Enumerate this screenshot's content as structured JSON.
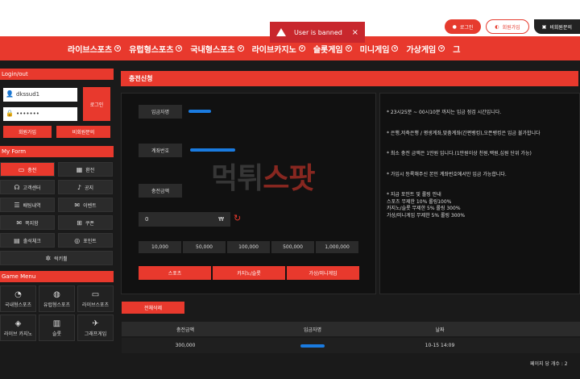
{
  "toast": {
    "message": "User is banned",
    "close": "×"
  },
  "top_buttons": [
    {
      "label": "로그인",
      "icon": "user-icon"
    },
    {
      "label": "회원가입",
      "icon": "user-plus-icon"
    },
    {
      "label": "비회원문의",
      "icon": "chat-icon"
    }
  ],
  "nav": [
    {
      "label": "라이브스포츠"
    },
    {
      "label": "유럽형스포츠"
    },
    {
      "label": "국내형스포츠"
    },
    {
      "label": "라이브카지노"
    },
    {
      "label": "슬롯게임"
    },
    {
      "label": "미니게임"
    },
    {
      "label": "가상게임"
    },
    {
      "label": "그"
    }
  ],
  "sidebar": {
    "login_title": "Login/out",
    "username": "dkssud1",
    "password": "•••••••",
    "login_button": "로그인",
    "signup_button": "회원가입",
    "inquiry_button": "비회원문의",
    "myform_title": "My Form",
    "form_items": [
      {
        "label": "충전",
        "icon": "wallet-icon"
      },
      {
        "label": "환전",
        "icon": "exchange-icon"
      },
      {
        "label": "고객센터",
        "icon": "headset-icon"
      },
      {
        "label": "공지",
        "icon": "bell-icon"
      },
      {
        "label": "배팅내역",
        "icon": "list-icon"
      },
      {
        "label": "이벤트",
        "icon": "gift-icon"
      },
      {
        "label": "쪽지함",
        "icon": "mail-icon"
      },
      {
        "label": "쿠폰",
        "icon": "coupon-icon"
      },
      {
        "label": "출석체크",
        "icon": "calendar-icon"
      },
      {
        "label": "포인트",
        "icon": "point-icon"
      }
    ],
    "form_last": {
      "label": "럭키휠",
      "icon": "wheel-icon"
    },
    "game_title": "Game Menu",
    "game_items": [
      {
        "label": "국내형스포츠",
        "icon": "ball-icon"
      },
      {
        "label": "유럽형스포츠",
        "icon": "globe-icon"
      },
      {
        "label": "라이브스포츠",
        "icon": "tv-icon"
      },
      {
        "label": "라이브 카지노",
        "icon": "chip-icon"
      },
      {
        "label": "슬롯",
        "icon": "slot-icon"
      },
      {
        "label": "그래프게임",
        "icon": "rocket-icon"
      }
    ]
  },
  "main": {
    "title": "충전신청",
    "depositor_label": "입금자명",
    "account_label": "계좌번호",
    "amount_label": "충전금액",
    "amount_value": "0",
    "currency": "₩",
    "quick_amounts": [
      "10,000",
      "50,000",
      "100,000",
      "500,000",
      "1,000,000"
    ],
    "action_buttons": [
      "스포츠",
      "카지노/슬롯",
      "가상/미니게임"
    ],
    "clear_all": "전체삭제"
  },
  "notice": [
    "* 23시25분 ~ 00시10분 까지는 입금 점검 시간입니다.",
    "* 은행,저축은행 / 평생계좌,맞춤계좌(간편뱅킹),오픈뱅킹은 입금 불가합니다",
    "* 최소 충전 금액은 1만원 입니다.(1만원이상 천원,백원,십원 단위 가능)",
    "* 가입시 등록해주신 본인 계좌번호에서만 입금 가능합니다.",
    "* 지급 포인트 및 롤링 안내\n스포츠 무제한 10% 롤링100%\n카지노/슬롯 무제한 5% 롤링 300%\n가상/미니게임 무제한 5% 롤링 300%"
  ],
  "watermark": {
    "part1": "먹튀",
    "part2": "스팟"
  },
  "table": {
    "headers": [
      "충전금액",
      "입금자명",
      "날짜",
      ""
    ],
    "rows": [
      {
        "amount": "300,000",
        "date": "10-15 14:09"
      }
    ]
  },
  "pager": "페이지 당 개수 : 2"
}
